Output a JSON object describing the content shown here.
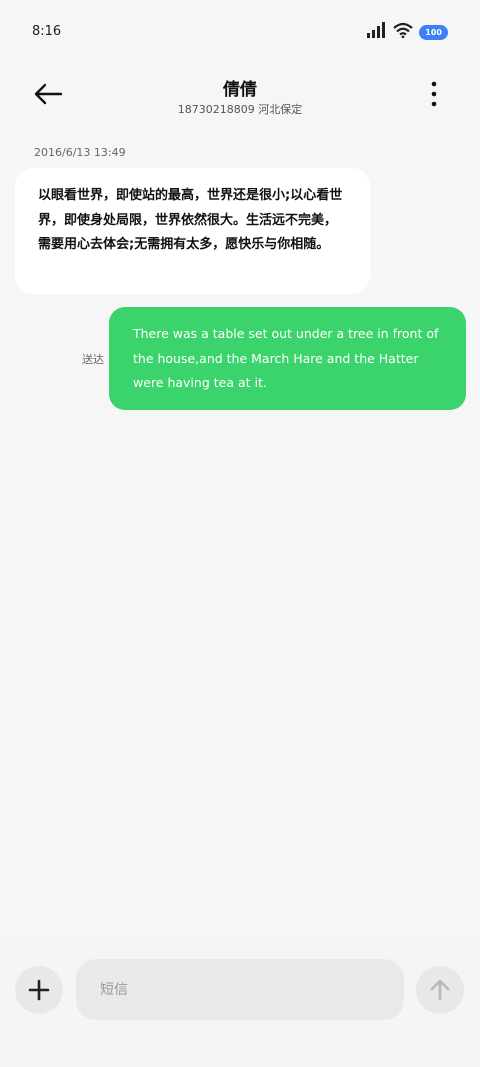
{
  "status_bar": {
    "time": "8:16",
    "battery": "100"
  },
  "header": {
    "contact_name": "倩倩",
    "contact_detail": "18730218809 河北保定"
  },
  "conversation": {
    "timestamp": "2016/6/13 13:49",
    "incoming_text": "以眼看世界，即使站的最高，世界还是很小;以心看世界，即使身处局限，世界依然很大。生活远不完美，需要用心去体会;无需拥有太多，愿快乐与你相随。",
    "outgoing_text": "There was a table set out under a tree in front of the house,and the March Hare and the Hatter were having tea at it.",
    "outgoing_status": "送达"
  },
  "composer": {
    "placeholder": "短信"
  },
  "colors": {
    "outgoing_bubble": "#3bd36b",
    "battery": "#3b82f6",
    "background": "#f6f6f6"
  }
}
